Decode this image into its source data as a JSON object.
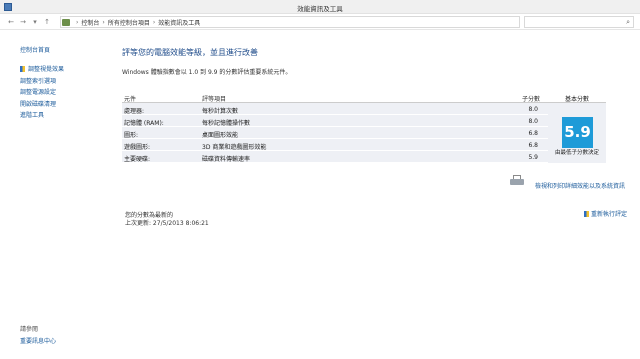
{
  "window": {
    "title": "效能資訊及工具"
  },
  "address": {
    "crumbs": [
      "控制台",
      "所有控制台項目",
      "效能資訊及工具"
    ],
    "separator": "›",
    "search_placeholder": ""
  },
  "sidebar": {
    "home": "控制台首頁",
    "items": [
      {
        "label": "調整視覺效果",
        "shield": true
      },
      {
        "label": "調整索引選項",
        "shield": false
      },
      {
        "label": "調整電源設定",
        "shield": false
      },
      {
        "label": "開啟磁碟清理",
        "shield": false
      },
      {
        "label": "進階工具",
        "shield": false
      }
    ],
    "see_also": "請參閱",
    "security": "重要訊息中心"
  },
  "main": {
    "heading": "評等您的電腦效能等級，並且進行改善",
    "subtext": "Windows 體驗指數會以 1.0 到 9.9 的分數評估重要系統元件。",
    "table": {
      "headers": {
        "component": "元件",
        "rated": "評等項目",
        "subscore": "子分數",
        "base": "基本分數"
      },
      "rows": [
        {
          "component": "處理器:",
          "rated": "每秒計算次數",
          "score": "8.0"
        },
        {
          "component": "記憶體 (RAM):",
          "rated": "每秒記憶體操作數",
          "score": "8.0"
        },
        {
          "component": "圖形:",
          "rated": "桌面圖形效能",
          "score": "6.8"
        },
        {
          "component": "遊戲圖形:",
          "rated": "3D 商業和遊戲圖形效能",
          "score": "6.8"
        },
        {
          "component": "主要硬碟:",
          "rated": "磁碟資料傳輸速率",
          "score": "5.9"
        }
      ]
    },
    "base_score": "5.9",
    "base_caption": "由最低子分數決定",
    "print_link": "檢視和列印詳細效能以及系統資訊",
    "last_rating_title": "您的分數為最新的",
    "last_update": "上次更新: 27/5/2013 8:06:21",
    "rerun": "重新執行評定"
  },
  "colors": {
    "accent": "#1e9bd8",
    "link": "#1a5a9a",
    "heading": "#1e4b8a"
  }
}
